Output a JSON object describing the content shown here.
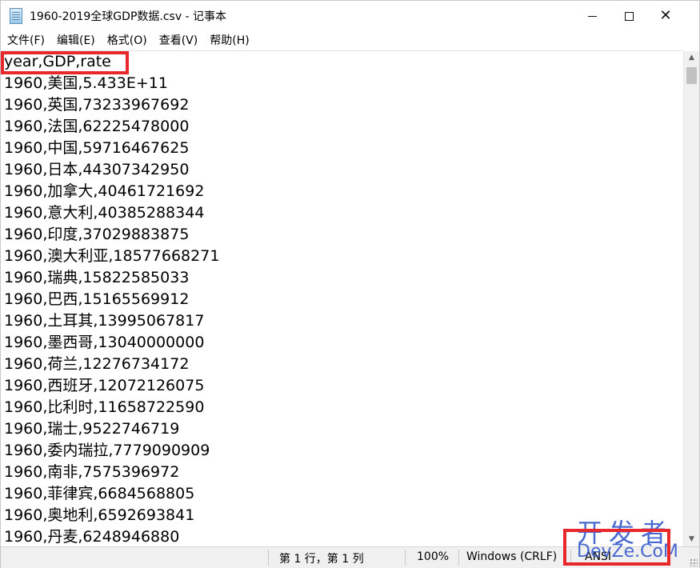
{
  "window": {
    "title": "1960-2019全球GDP数据.csv - 记事本",
    "icon": "notepad-icon"
  },
  "titlebar_buttons": {
    "minimize": "minimize-icon",
    "maximize": "maximize-icon",
    "close_glyph": "✕"
  },
  "menu": {
    "items": [
      {
        "label": "文件(F)"
      },
      {
        "label": "编辑(E)"
      },
      {
        "label": "格式(O)"
      },
      {
        "label": "查看(V)"
      },
      {
        "label": "帮助(H)"
      }
    ]
  },
  "editor": {
    "lines": [
      "year,GDP,rate",
      "1960,美国,5.433E+11",
      "1960,英国,73233967692",
      "1960,法国,62225478000",
      "1960,中国,59716467625",
      "1960,日本,44307342950",
      "1960,加拿大,40461721692",
      "1960,意大利,40385288344",
      "1960,印度,37029883875",
      "1960,澳大利亚,18577668271",
      "1960,瑞典,15822585033",
      "1960,巴西,15165569912",
      "1960,土耳其,13995067817",
      "1960,墨西哥,13040000000",
      "1960,荷兰,12276734172",
      "1960,西班牙,12072126075",
      "1960,比利时,11658722590",
      "1960,瑞士,9522746719",
      "1960,委内瑞拉,7779090909",
      "1960,南非,7575396972",
      "1960,菲律宾,6684568805",
      "1960,奥地利,6592693841",
      "1960,丹麦,6248946880"
    ]
  },
  "scrollbar": {
    "up_arrow": "▲",
    "down_arrow": "▼"
  },
  "status": {
    "position": "第 1 行，第 1 列",
    "zoom": "100%",
    "line_ending": "Windows (CRLF)",
    "encoding": "ANSI"
  },
  "watermark": {
    "top": "开发者",
    "bottom": "DevZe.CoM"
  },
  "colors": {
    "annotation_red": "#e8282b",
    "watermark_blue": "#2850c8"
  }
}
